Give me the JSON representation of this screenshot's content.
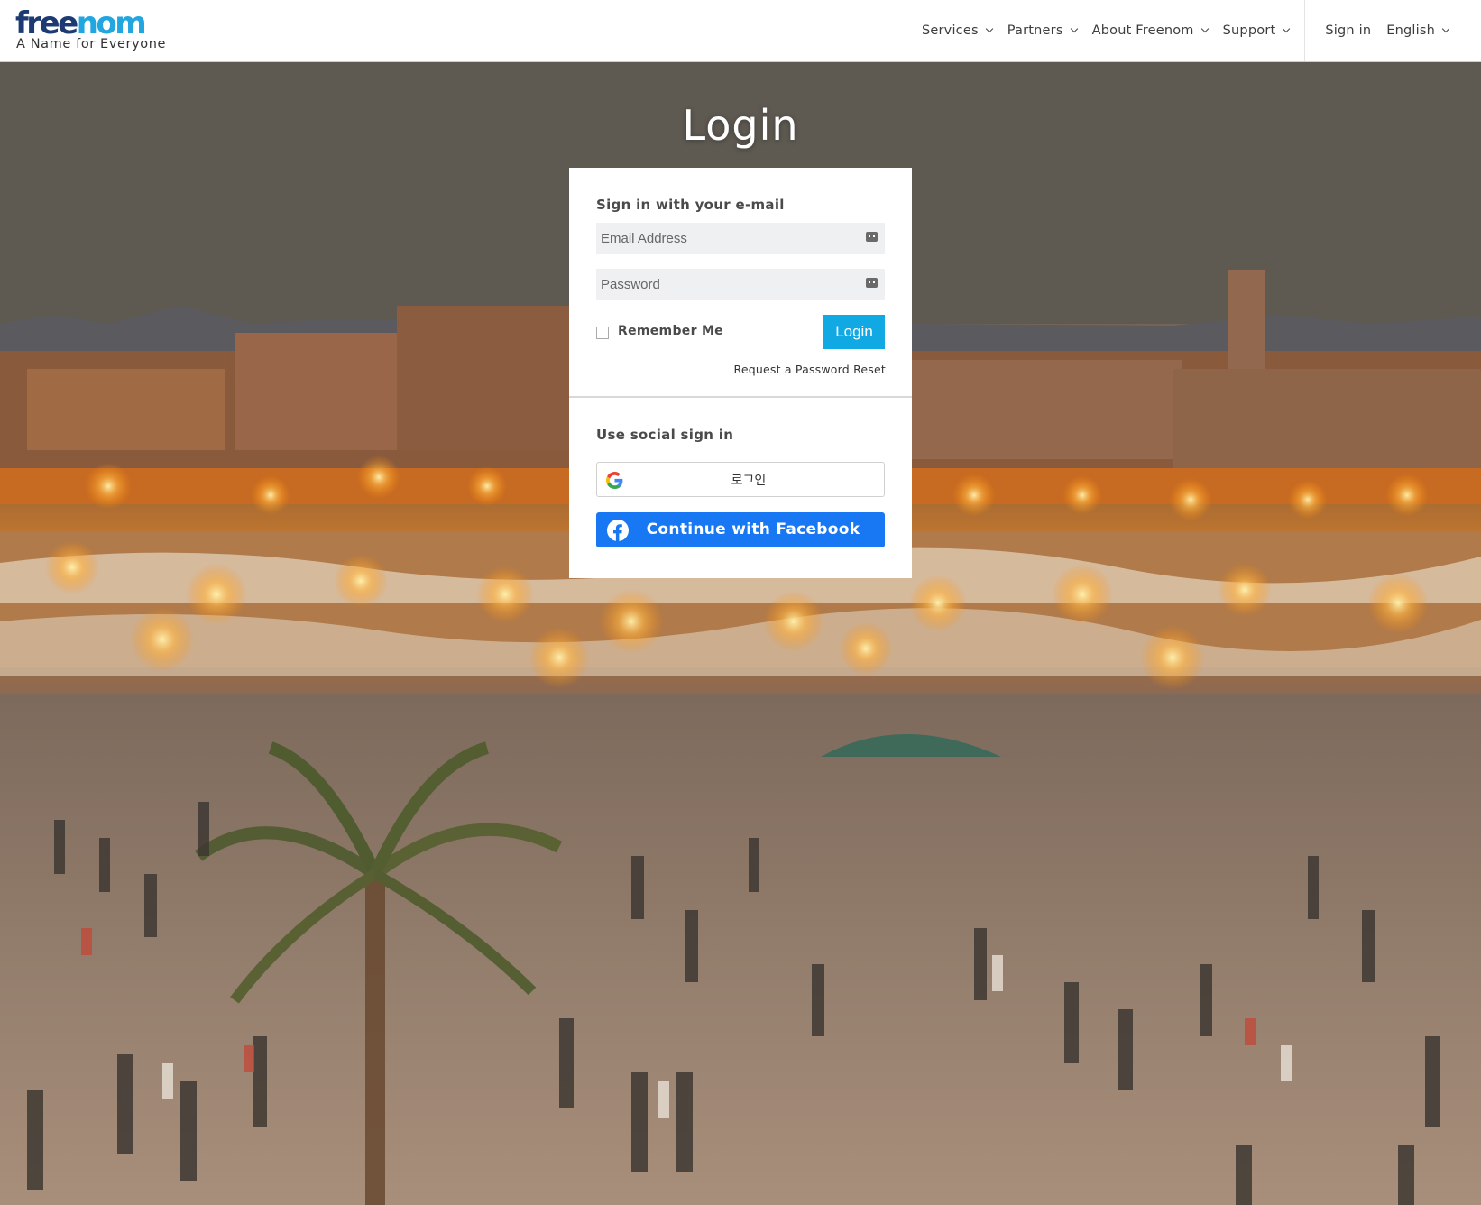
{
  "header": {
    "logo_word_1": "free",
    "logo_word_2": "nom",
    "tagline": "A Name for Everyone",
    "nav": [
      {
        "label": "Services"
      },
      {
        "label": "Partners"
      },
      {
        "label": "About Freenom"
      },
      {
        "label": "Support"
      }
    ],
    "sign_in": "Sign in",
    "language": "English"
  },
  "page": {
    "title": "Login"
  },
  "login_form": {
    "email_section_title": "Sign in with your e-mail",
    "email_placeholder": "Email Address",
    "password_placeholder": "Password",
    "remember_me": "Remember Me",
    "remember_checked": false,
    "login_button": "Login",
    "password_reset_link": "Request a Password Reset"
  },
  "social": {
    "section_title": "Use social sign in",
    "google_button": "로그인",
    "facebook_button": "Continue with Facebook"
  },
  "colors": {
    "brand_dark": "#1d3b72",
    "brand_light": "#22a6e0",
    "login_button": "#10a9e3",
    "facebook": "#1877f2"
  },
  "icons": [
    "chevron-down-icon",
    "keyboard-icon",
    "google-icon",
    "facebook-icon"
  ]
}
